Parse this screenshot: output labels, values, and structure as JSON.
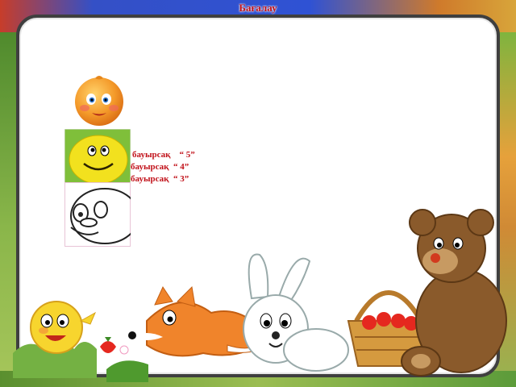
{
  "title": "Бағалау",
  "grades": [
    {
      "label": "бауырсақ",
      "grade": "“ 5”"
    },
    {
      "label": "бауырсақ",
      "grade": "“ 4”"
    },
    {
      "label": "бауырсақ",
      "grade": "“ 3”"
    }
  ],
  "colors": {
    "title": "#c1121a",
    "legend": "#c1121a",
    "panel_border": "#3f3f3f"
  }
}
